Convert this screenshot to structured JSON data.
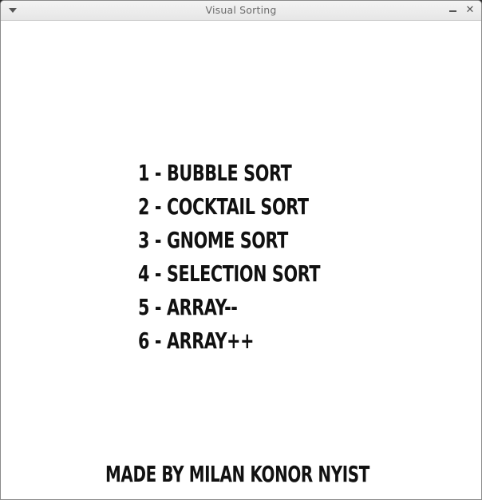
{
  "window": {
    "title": "Visual Sorting",
    "minimize_glyph": "minimize-icon",
    "close_glyph": "✕"
  },
  "menu": {
    "items": [
      {
        "label": "1 - BUBBLE SORT"
      },
      {
        "label": "2 - COCKTAIL SORT"
      },
      {
        "label": "3 - GNOME SORT"
      },
      {
        "label": "4 - SELECTION SORT"
      },
      {
        "label": "5 - ARRAY--"
      },
      {
        "label": "6 - ARRAY++"
      }
    ]
  },
  "footer": {
    "credit": "MADE BY MILAN KONOR NYIST"
  },
  "colors": {
    "background": "#ffffff",
    "text": "#111111",
    "titlebar": "#ececec"
  }
}
